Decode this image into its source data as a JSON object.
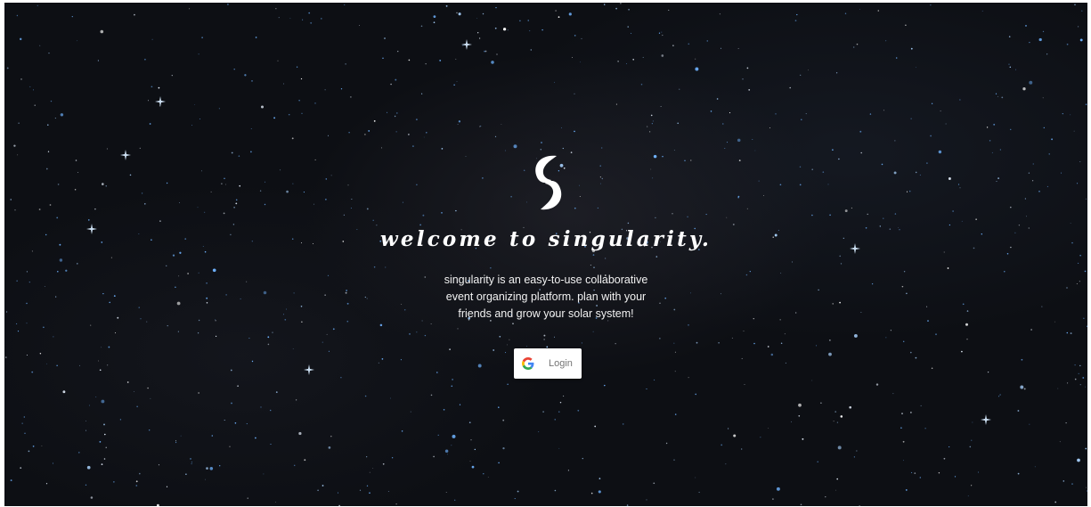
{
  "hero": {
    "headline": "welcome to singularity.",
    "tagline_lines": [
      "singularity is an easy-to-use collaborative",
      "event organizing platform. plan with your",
      "friends and grow your solar system!"
    ],
    "login_label": "Login"
  },
  "icons": {
    "logo": "singularity-swirl-logo",
    "google": "google-g-icon"
  },
  "colors": {
    "background": "#0d0f14",
    "text": "#ffffff",
    "button_bg": "#ffffff",
    "button_text": "#757575",
    "star_blue": "#6fb3ff"
  }
}
